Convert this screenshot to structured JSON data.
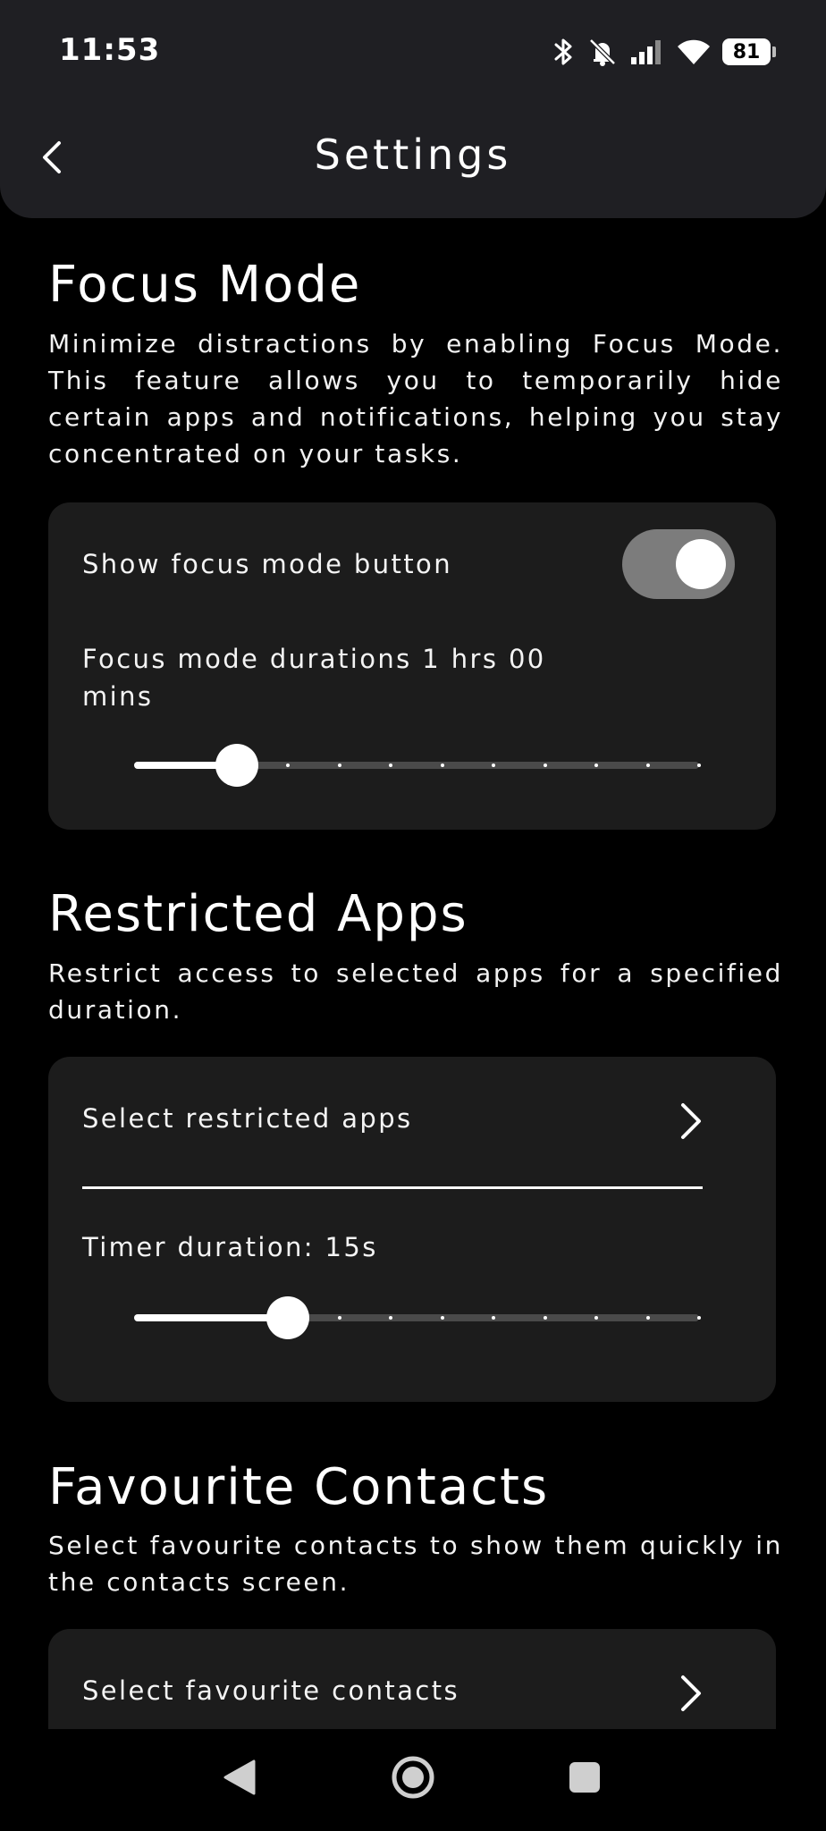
{
  "status_bar": {
    "time": "11:53",
    "battery_level": "81",
    "icons": [
      "bluetooth-icon",
      "notifications-off-icon",
      "signal-icon",
      "wifi-icon",
      "battery-icon"
    ]
  },
  "header": {
    "title": "Settings",
    "back_icon": "chevron-left-icon"
  },
  "focus_mode": {
    "title": "Focus Mode",
    "description": "Minimize distractions by enabling Focus Mode. This feature allows you to temporarily hide certain apps and notifications, helping you stay concentrated on your tasks.",
    "toggle_label": "Show focus mode button",
    "toggle_on": true,
    "duration_label": "Focus mode durations 1 hrs 00 mins",
    "slider": {
      "steps": 12,
      "value_index": 2
    }
  },
  "restricted_apps": {
    "title": "Restricted Apps",
    "description": "Restrict access to selected apps for a specified duration.",
    "select_label": "Select restricted apps",
    "timer_label": "Timer duration:  15s",
    "slider": {
      "steps": 12,
      "value_index": 3
    }
  },
  "favourite_contacts": {
    "title": "Favourite Contacts",
    "description": "Select favourite contacts to show them quickly in the contacts screen.",
    "select_label": "Select favourite contacts"
  },
  "colors": {
    "background": "#000000",
    "header": "#1f1f23",
    "card": "#1c1c1c",
    "toggle_track": "#7c7c7c",
    "accent": "#ffffff"
  },
  "navbar": {
    "icons": [
      "back-triangle-icon",
      "home-circle-icon",
      "recents-square-icon"
    ]
  }
}
